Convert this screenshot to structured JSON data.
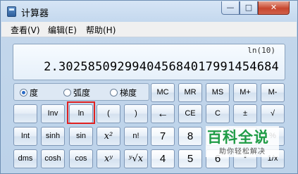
{
  "window": {
    "title": "计算器",
    "controls": {
      "minimize": "—",
      "maximize": "□",
      "close": "✕"
    }
  },
  "menu": [
    "查看(V)",
    "编辑(E)",
    "帮助(H)"
  ],
  "display": {
    "expression": "ln(10)",
    "result": "2.302585092994045684017991454684"
  },
  "angle_mode": {
    "options": [
      "度",
      "弧度",
      "梯度"
    ],
    "selected": "度"
  },
  "memory_buttons": [
    "MC",
    "MR",
    "MS",
    "M+",
    "M-"
  ],
  "rows": {
    "row2": [
      "",
      "Inv",
      "ln",
      "(",
      ")",
      "←",
      "CE",
      "C",
      "±",
      "√"
    ],
    "row3": [
      "Int",
      "sinh",
      "sin",
      "x²",
      "n!",
      "7",
      "8",
      "9",
      "/",
      "%"
    ],
    "row4": [
      "dms",
      "cosh",
      "cos",
      "xʸ",
      "ʸ√x",
      "4",
      "5",
      "6",
      "*",
      "1/x"
    ]
  },
  "highlighted_button": "ln",
  "watermark": {
    "main": "百科全说",
    "sub": "助你轻松解决"
  }
}
